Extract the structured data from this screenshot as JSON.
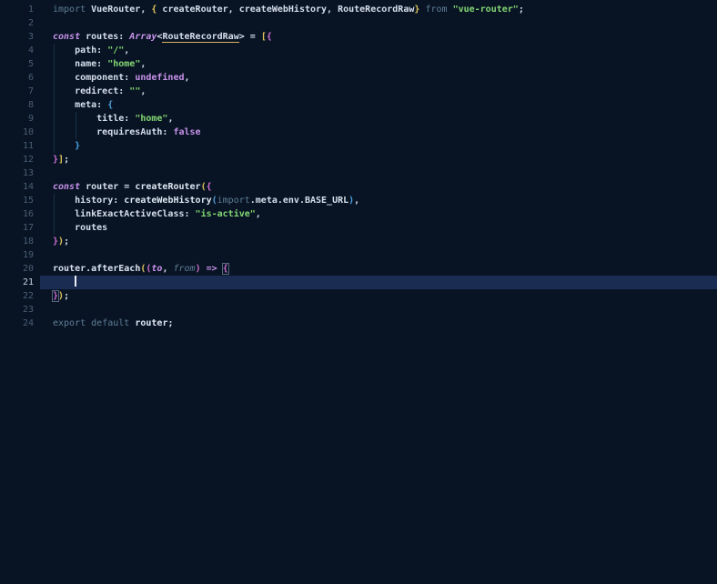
{
  "editor": {
    "language": "typescript",
    "active_line": 21,
    "cursor": {
      "line": 21,
      "column": 5
    },
    "colors": {
      "background": "#081424",
      "active_line_highlight": "#1b2c52",
      "default_text": "#d6deeb",
      "keyword": "#5f7e97",
      "keyword_magenta": "#c792ea",
      "string": "#82d673",
      "bracket_level1": "#e2c55c",
      "bracket_level2": "#cd6fd1",
      "bracket_level3": "#4aa2dd",
      "line_number": "#4c5e74",
      "line_number_active": "#c9d3e0",
      "type_underline": "#d9b35e",
      "bracket_match_box": "#56687e",
      "cursor": "#e9eef6"
    },
    "lines": [
      {
        "num": 1,
        "tokens": [
          [
            "kw",
            "import"
          ],
          [
            "txt",
            " VueRouter, "
          ],
          [
            "b1",
            "{"
          ],
          [
            "txt",
            " createRouter, createWebHistory, RouteRecordRaw"
          ],
          [
            "b1",
            "}"
          ],
          [
            "txt",
            " "
          ],
          [
            "kw",
            "from"
          ],
          [
            "txt",
            " "
          ],
          [
            "str",
            "\"vue-router\""
          ],
          [
            "txt",
            ";"
          ]
        ]
      },
      {
        "num": 2,
        "tokens": []
      },
      {
        "num": 3,
        "tokens": [
          [
            "mi",
            "const"
          ],
          [
            "txt",
            " routes: "
          ],
          [
            "mi",
            "Array"
          ],
          [
            "txt",
            "<"
          ],
          [
            "tu",
            "RouteRecordRaw"
          ],
          [
            "txt",
            "> = "
          ],
          [
            "b1",
            "["
          ],
          [
            "b2",
            "{"
          ]
        ]
      },
      {
        "num": 4,
        "tokens": [
          [
            "txt",
            "    path: "
          ],
          [
            "str",
            "\"/\""
          ],
          [
            "txt",
            ","
          ]
        ]
      },
      {
        "num": 5,
        "tokens": [
          [
            "txt",
            "    name: "
          ],
          [
            "str",
            "\"home\""
          ],
          [
            "txt",
            ","
          ]
        ]
      },
      {
        "num": 6,
        "tokens": [
          [
            "txt",
            "    component: "
          ],
          [
            "m",
            "undefined"
          ],
          [
            "txt",
            ","
          ]
        ]
      },
      {
        "num": 7,
        "tokens": [
          [
            "txt",
            "    redirect: "
          ],
          [
            "str",
            "\"\""
          ],
          [
            "txt",
            ","
          ]
        ]
      },
      {
        "num": 8,
        "tokens": [
          [
            "txt",
            "    meta: "
          ],
          [
            "b3",
            "{"
          ]
        ]
      },
      {
        "num": 9,
        "tokens": [
          [
            "txt",
            "        title: "
          ],
          [
            "str",
            "\"home\""
          ],
          [
            "txt",
            ","
          ]
        ]
      },
      {
        "num": 10,
        "tokens": [
          [
            "txt",
            "        requiresAuth: "
          ],
          [
            "m",
            "false"
          ]
        ]
      },
      {
        "num": 11,
        "tokens": [
          [
            "txt",
            "    "
          ],
          [
            "b3",
            "}"
          ]
        ]
      },
      {
        "num": 12,
        "tokens": [
          [
            "b2",
            "}"
          ],
          [
            "b1",
            "]"
          ],
          [
            "txt",
            ";"
          ]
        ]
      },
      {
        "num": 13,
        "tokens": []
      },
      {
        "num": 14,
        "tokens": [
          [
            "mi",
            "const"
          ],
          [
            "txt",
            " router = "
          ],
          [
            "fn",
            "createRouter"
          ],
          [
            "b1",
            "("
          ],
          [
            "b2",
            "{"
          ]
        ]
      },
      {
        "num": 15,
        "tokens": [
          [
            "txt",
            "    history: "
          ],
          [
            "fn",
            "createWebHistory"
          ],
          [
            "b3",
            "("
          ],
          [
            "kw",
            "import"
          ],
          [
            "txt",
            ".meta.env.BASE_URL"
          ],
          [
            "b3",
            ")"
          ],
          [
            "txt",
            ","
          ]
        ]
      },
      {
        "num": 16,
        "tokens": [
          [
            "txt",
            "    linkExactActiveClass: "
          ],
          [
            "str",
            "\"is-active\""
          ],
          [
            "txt",
            ","
          ]
        ]
      },
      {
        "num": 17,
        "tokens": [
          [
            "txt",
            "    routes"
          ]
        ]
      },
      {
        "num": 18,
        "tokens": [
          [
            "b2",
            "}"
          ],
          [
            "b1",
            ")"
          ],
          [
            "txt",
            ";"
          ]
        ]
      },
      {
        "num": 19,
        "tokens": []
      },
      {
        "num": 20,
        "tokens": [
          [
            "txt",
            "router."
          ],
          [
            "fn",
            "afterEach"
          ],
          [
            "b1",
            "("
          ],
          [
            "b2",
            "("
          ],
          [
            "mi",
            "to"
          ],
          [
            "txt",
            ", "
          ],
          [
            "kwi",
            "from"
          ],
          [
            "b2",
            ")"
          ],
          [
            "txt",
            " "
          ],
          [
            "m",
            "=>"
          ],
          [
            "txt",
            " "
          ],
          [
            "b2m",
            "{"
          ]
        ]
      },
      {
        "num": 21,
        "tokens": [
          [
            "txt",
            "    "
          ],
          [
            "cursor",
            ""
          ]
        ]
      },
      {
        "num": 22,
        "tokens": [
          [
            "b2m",
            "}"
          ],
          [
            "b1",
            ")"
          ],
          [
            "txt",
            ";"
          ]
        ]
      },
      {
        "num": 23,
        "tokens": []
      },
      {
        "num": 24,
        "tokens": [
          [
            "kw",
            "export"
          ],
          [
            "txt",
            " "
          ],
          [
            "kw",
            "default"
          ],
          [
            "txt",
            " "
          ],
          [
            "fn",
            "router"
          ],
          [
            "txt",
            ";"
          ]
        ]
      }
    ]
  }
}
